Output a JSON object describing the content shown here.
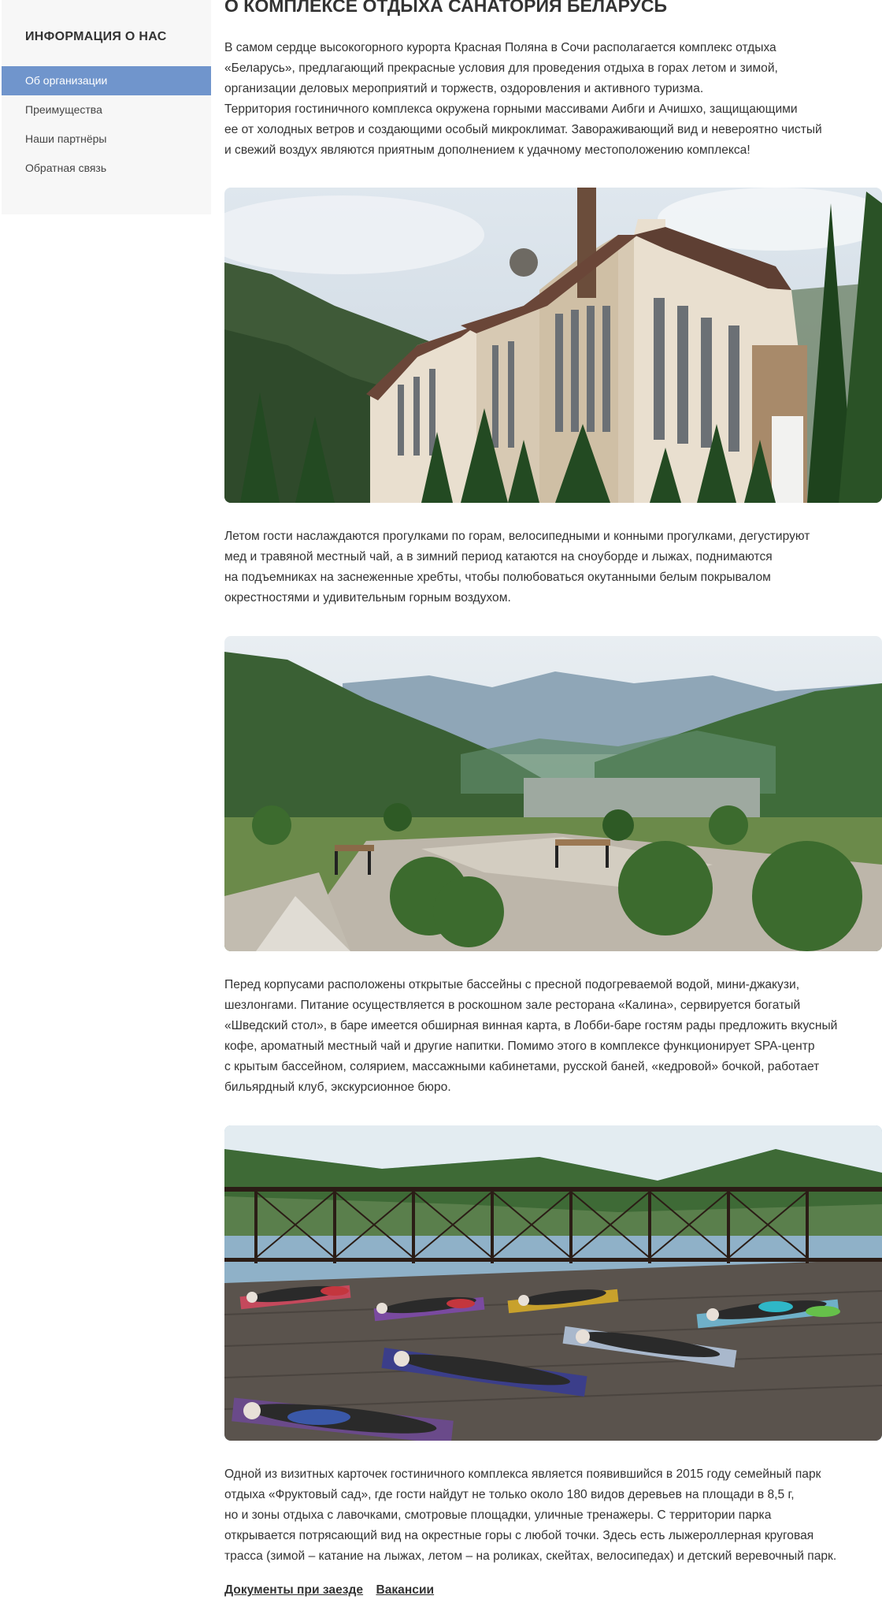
{
  "sidebar": {
    "title": "ИНФОРМАЦИЯ О НАС",
    "items": [
      {
        "label": "Об организации",
        "active": true
      },
      {
        "label": "Преимущества",
        "active": false
      },
      {
        "label": "Наши партнёры",
        "active": false
      },
      {
        "label": "Обратная связь",
        "active": false
      }
    ]
  },
  "main": {
    "title": "О КОМПЛЕКСЕ ОТДЫХА САНАТОРИЯ БЕЛАРУСЬ",
    "paragraphs": [
      [
        "В самом сердце высокогорного курорта Красная Поляна в Сочи располагается комплекс отдыха",
        "«Беларусь», предлагающий прекрасные условия для проведения отдыха в горах летом и зимой,",
        "организации деловых мероприятий и торжеств, оздоровления и активного туризма.",
        "Территория гостиничного комплекса окружена горными массивами Аибги и Ачишхо, защищающими",
        "ее от холодных ветров и создающими особый микроклимат. Завораживающий вид и невероятно чистый",
        "и свежий воздух являются приятным дополнением к удачному местоположению комплекса!"
      ],
      [
        "Летом гости наслаждаются прогулками по горам, велосипедными и конными прогулками, дегустируют",
        "мед и травяной местный чай, а в зимний период катаются на сноуборде и лыжах, поднимаются",
        "на подъемниках на заснеженные хребты, чтобы полюбоваться окутанными белым покрывалом",
        "окрестностями и удивительным горным воздухом."
      ],
      [
        "Перед корпусами расположены открытые бассейны с пресной подогреваемой водой, мини-джакузи,",
        "шезлонгами. Питание осуществляется в роскошном зале ресторана «Калина», сервируется богатый",
        "«Шведский стол», в баре имеется обширная винная карта, в Лобби-баре гостям рады предложить вкусный",
        "кофе, ароматный местный чай и другие напитки. Помимо этого в комплексе функционирует SPA-центр",
        "с крытым бассейном, солярием, массажными кабинетами, русской баней, «кедровой» бочкой, работает",
        "бильярдный клуб, экскурсионное бюро."
      ],
      [
        "Одной из визитных карточек гостиничного комплекса является появившийся в 2015 году семейный парк",
        "отдыха «Фруктовый сад», где гости найдут не только около 180 видов деревьев на площади в 8,5 г,",
        "но и зоны отдыха с лавочками, смотровые площадки, уличные тренажеры. С территории парка",
        "открывается потрясающий вид на окрестные горы с любой точки. Здесь есть лыжероллерная круговая",
        "трасса (зимой – катание на лыжах, летом – на роликах, скейтах, велосипедах) и детский веревочный парк."
      ]
    ],
    "photos": [
      "hotel-building-photo",
      "mountain-valley-park-photo",
      "yoga-terrace-photo"
    ],
    "links": [
      "Документы при заезде",
      "Вакансии"
    ]
  },
  "colors": {
    "accent": "#7095cc",
    "sidebar_bg": "#f7f7f7",
    "text": "#333333"
  }
}
